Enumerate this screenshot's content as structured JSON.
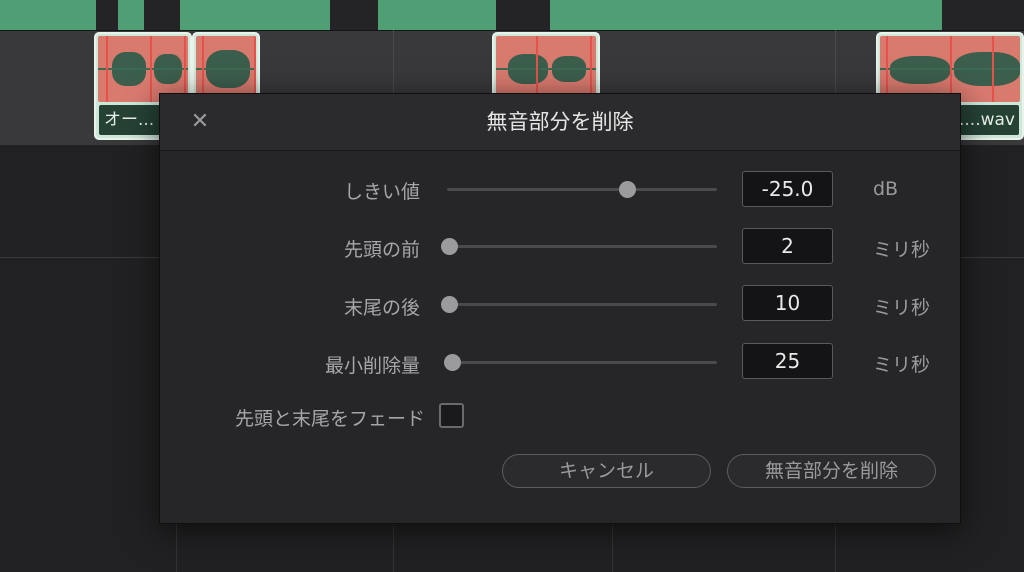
{
  "timeline": {
    "clip_names": [
      "オー...",
      "",
      "",
      "....wav"
    ]
  },
  "dialog": {
    "title": "無音部分を削除",
    "close_icon": "close-icon",
    "rows": [
      {
        "label": "しきい値",
        "value": "-25.0",
        "unit": "dB",
        "slider_fraction": 0.67
      },
      {
        "label": "先頭の前",
        "value": "2",
        "unit": "ミリ秒",
        "slider_fraction": 0.0
      },
      {
        "label": "末尾の後",
        "value": "10",
        "unit": "ミリ秒",
        "slider_fraction": 0.0
      },
      {
        "label": "最小削除量",
        "value": "25",
        "unit": "ミリ秒",
        "slider_fraction": 0.01
      }
    ],
    "fade_label": "先頭と末尾をフェード",
    "fade_checked": false,
    "cancel_label": "キャンセル",
    "confirm_label": "無音部分を削除"
  },
  "colors": {
    "clip_green": "#4f9e74",
    "silence_red": "#d97a6f"
  }
}
